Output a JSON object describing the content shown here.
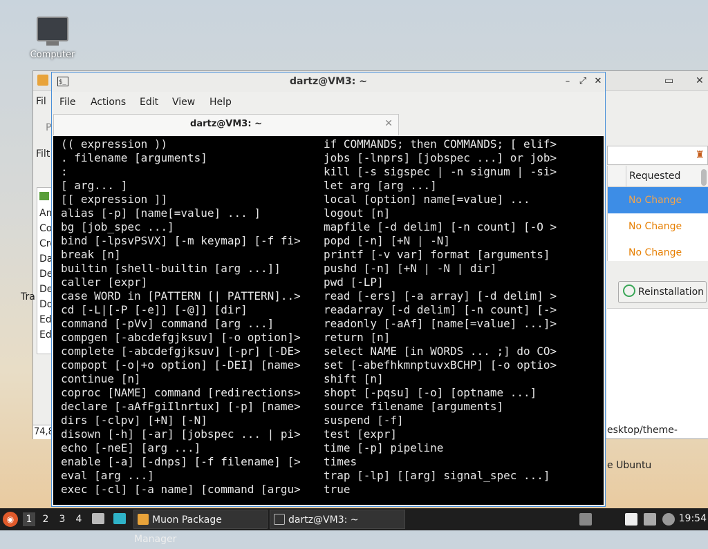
{
  "desktop": {
    "icon_label": "Computer"
  },
  "muon": {
    "menu_fragment": "Fil",
    "p_fragment": "P",
    "filter_fragment": "Filt",
    "list_items": [
      "Am",
      "Co",
      "Cro",
      "Da",
      "De",
      "De",
      "Do",
      "Ed",
      "Ed"
    ],
    "tra_fragment": "Tra",
    "status_fragment": "74,8",
    "table_header_requested": "Requested",
    "table_rows": [
      "No Change",
      "No Change",
      "No Change"
    ],
    "reinstall_button": "Reinstallation",
    "desc_line1": "esktop/theme-",
    "desc_line2": "e Ubuntu"
  },
  "terminal": {
    "title": "dartz@VM3: ~",
    "tab_label": "dartz@VM3: ~",
    "menu": [
      "File",
      "Actions",
      "Edit",
      "View",
      "Help"
    ],
    "left_column": [
      "(( expression ))",
      ". filename [arguments]",
      ":",
      "[ arg... ]",
      "[[ expression ]]",
      "alias [-p] [name[=value] ... ]",
      "bg [job_spec ...]",
      "bind [-lpsvPSVX] [-m keymap] [-f fi>",
      "break [n]",
      "builtin [shell-builtin [arg ...]]",
      "caller [expr]",
      "case WORD in [PATTERN [| PATTERN]..>",
      "cd [-L|[-P [-e]] [-@]] [dir]",
      "command [-pVv] command [arg ...]",
      "compgen [-abcdefgjksuv] [-o option]>",
      "complete [-abcdefgjksuv] [-pr] [-DE>",
      "compopt [-o|+o option] [-DEI] [name>",
      "continue [n]",
      "coproc [NAME] command [redirections>",
      "declare [-aAfFgiIlnrtux] [-p] [name>",
      "dirs [-clpv] [+N] [-N]",
      "disown [-h] [-ar] [jobspec ... | pi>",
      "echo [-neE] [arg ...]",
      "enable [-a] [-dnps] [-f filename] [>",
      "eval [arg ...]",
      "exec [-cl] [-a name] [command [argu>"
    ],
    "right_column": [
      "if COMMANDS; then COMMANDS; [ elif>",
      "jobs [-lnprs] [jobspec ...] or job>",
      "kill [-s sigspec | -n signum | -si>",
      "let arg [arg ...]",
      "local [option] name[=value] ...",
      "logout [n]",
      "mapfile [-d delim] [-n count] [-O >",
      "popd [-n] [+N | -N]",
      "printf [-v var] format [arguments]",
      "pushd [-n] [+N | -N | dir]",
      "pwd [-LP]",
      "read [-ers] [-a array] [-d delim] >",
      "readarray [-d delim] [-n count] [->",
      "readonly [-aAf] [name[=value] ...]>",
      "return [n]",
      "select NAME [in WORDS ... ;] do CO>",
      "set [-abefhkmnptuvxBCHP] [-o optio>",
      "shift [n]",
      "shopt [-pqsu] [-o] [optname ...]",
      "source filename [arguments]",
      "suspend [-f]",
      "test [expr]",
      "time [-p] pipeline",
      "times",
      "trap [-lp] [[arg] signal_spec ...]",
      "true"
    ]
  },
  "taskbar": {
    "workspaces": [
      "1",
      "2",
      "3",
      "4"
    ],
    "task_muon": "Muon Package Manager",
    "task_terminal": "dartz@VM3: ~",
    "clock": "19:54"
  }
}
